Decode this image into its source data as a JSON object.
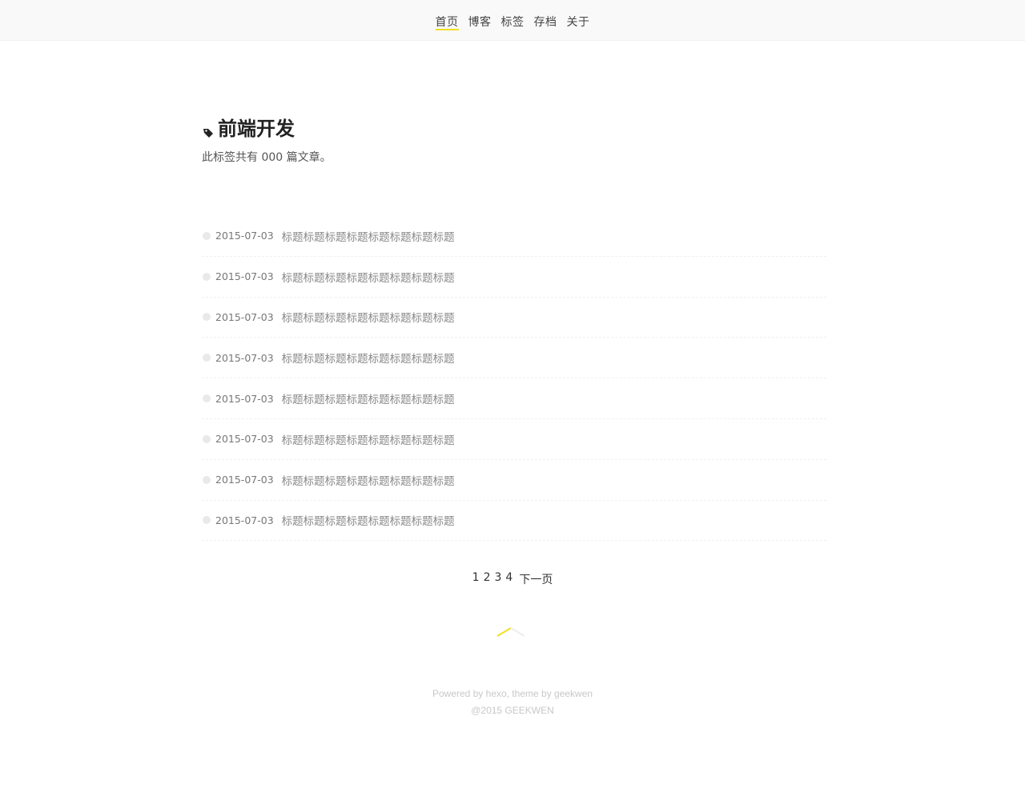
{
  "nav": {
    "items": [
      {
        "label": "首页",
        "active": true
      },
      {
        "label": "博客",
        "active": false
      },
      {
        "label": "标签",
        "active": false
      },
      {
        "label": "存档",
        "active": false
      },
      {
        "label": "关于",
        "active": false
      }
    ]
  },
  "tag": {
    "icon": "tag-icon",
    "name": "前端开发",
    "count_text": "此标签共有 000 篇文章。"
  },
  "posts": [
    {
      "date": "2015-07-03",
      "title": "标题标题标题标题标题标题标题标题"
    },
    {
      "date": "2015-07-03",
      "title": "标题标题标题标题标题标题标题标题"
    },
    {
      "date": "2015-07-03",
      "title": "标题标题标题标题标题标题标题标题"
    },
    {
      "date": "2015-07-03",
      "title": "标题标题标题标题标题标题标题标题"
    },
    {
      "date": "2015-07-03",
      "title": "标题标题标题标题标题标题标题标题"
    },
    {
      "date": "2015-07-03",
      "title": "标题标题标题标题标题标题标题标题"
    },
    {
      "date": "2015-07-03",
      "title": "标题标题标题标题标题标题标题标题"
    },
    {
      "date": "2015-07-03",
      "title": "标题标题标题标题标题标题标题标题"
    }
  ],
  "pagination": {
    "pages": [
      "1",
      "2",
      "3",
      "4"
    ],
    "next_label": "下一页"
  },
  "back_to_top": {
    "icon": "chevron-up-icon"
  },
  "footer": {
    "powered": "Powered by hexo, theme by geekwen",
    "copyright": "@2015  GEEKWEN"
  },
  "colors": {
    "accent": "#f0e020",
    "topbar_bg": "#f9f9f9"
  }
}
